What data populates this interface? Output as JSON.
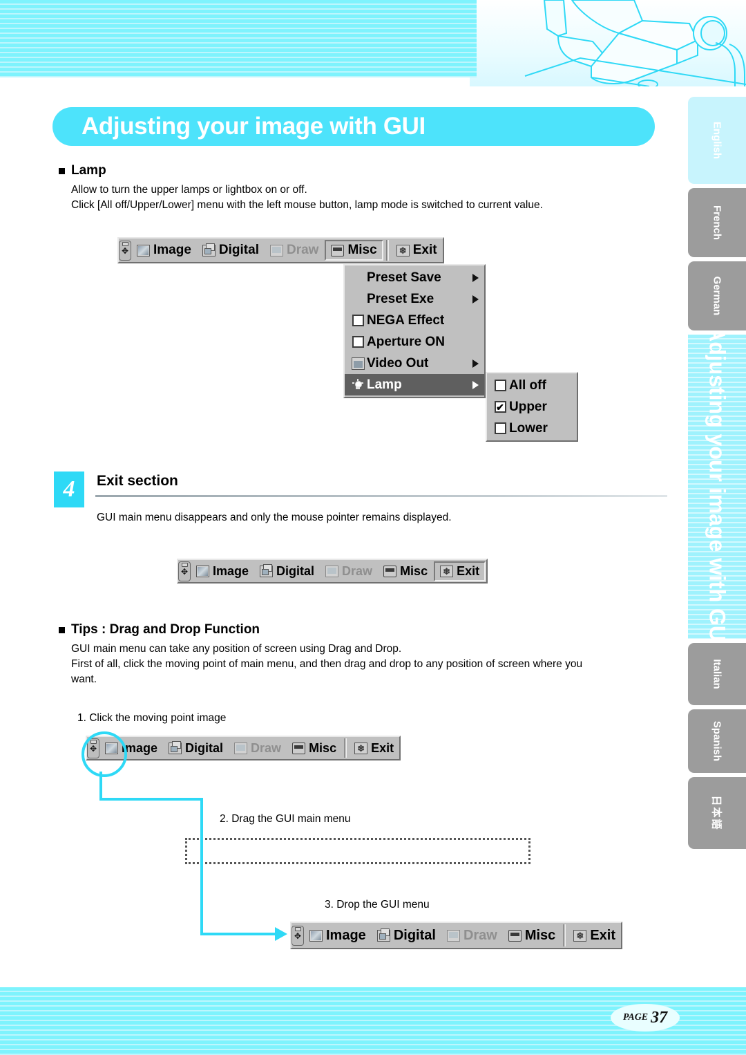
{
  "page": {
    "title": "Adjusting your image with GUI",
    "page_label": "PAGE",
    "page_number": "37"
  },
  "colors": {
    "accent_cyan": "#2ed9f6",
    "title_pill": "#4de3fb",
    "band_stripe": "#7ef3fd",
    "tab_inactive": "#9c9c9c",
    "tab_active": "#c8f4fd",
    "menu_face": "#c0c0c0",
    "menu_selected": "#5f5f5f"
  },
  "lamp_section": {
    "heading": "Lamp",
    "line1": "Allow to turn the upper lamps or lightbox on or off.",
    "line2": "Click [All off/Upper/Lower] menu with the left mouse button, lamp mode is switched to current value."
  },
  "toolbar": {
    "handle_icon": "move-handle-icon",
    "items": [
      {
        "label": "Image",
        "icon": "image-icon",
        "state": "normal"
      },
      {
        "label": "Digital",
        "icon": "digital-icon",
        "state": "normal"
      },
      {
        "label": "Draw",
        "icon": "draw-icon",
        "state": "disabled"
      },
      {
        "label": "Misc",
        "icon": "misc-icon",
        "state": "pressed"
      },
      {
        "label": "Exit",
        "icon": "exit-icon",
        "state": "normal"
      }
    ]
  },
  "toolbar_exit": {
    "items": [
      {
        "label": "Image",
        "state": "normal"
      },
      {
        "label": "Digital",
        "state": "normal"
      },
      {
        "label": "Draw",
        "state": "disabled"
      },
      {
        "label": "Misc",
        "state": "normal"
      },
      {
        "label": "Exit",
        "state": "pressed"
      }
    ]
  },
  "misc_menu": {
    "items": [
      {
        "label": "Preset Save",
        "gutter": "none",
        "submenu": true,
        "selected": false
      },
      {
        "label": "Preset Exe",
        "gutter": "none",
        "submenu": true,
        "selected": false
      },
      {
        "label": "NEGA Effect",
        "gutter": "checkbox",
        "checked": false,
        "submenu": false,
        "selected": false
      },
      {
        "label": "Aperture ON",
        "gutter": "checkbox",
        "checked": false,
        "submenu": false,
        "selected": false
      },
      {
        "label": "Video Out",
        "gutter": "video-icon",
        "submenu": true,
        "selected": false
      },
      {
        "label": "Lamp",
        "gutter": "lamp-icon",
        "submenu": true,
        "selected": true
      }
    ]
  },
  "lamp_submenu": {
    "items": [
      {
        "label": "All off",
        "checked": false
      },
      {
        "label": "Upper",
        "checked": true
      },
      {
        "label": "Lower",
        "checked": false
      }
    ],
    "check_glyph": "✔"
  },
  "exit_section": {
    "number": "4",
    "title": "Exit section",
    "body": "GUI main menu disappears and only the mouse pointer remains displayed."
  },
  "tips_section": {
    "heading": "Tips : Drag and Drop Function",
    "line1": "GUI main menu can take any position of screen using Drag and Drop.",
    "line2": "First of all, click the moving point of main menu, and then drag and drop to any position of screen where you",
    "line3": "want.",
    "step1": "1. Click the moving point image",
    "step2": "2. Drag the GUI main menu",
    "step3": "3. Drop the GUI menu"
  },
  "language_tabs": [
    {
      "label": "English",
      "active": true
    },
    {
      "label": "French",
      "active": false
    },
    {
      "label": "German",
      "active": false
    },
    {
      "label": "Italian",
      "active": false
    },
    {
      "label": "Spanish",
      "active": false
    },
    {
      "label": "日本語",
      "active": false
    }
  ],
  "sidebar_title": "Adjusting your image with GUI"
}
